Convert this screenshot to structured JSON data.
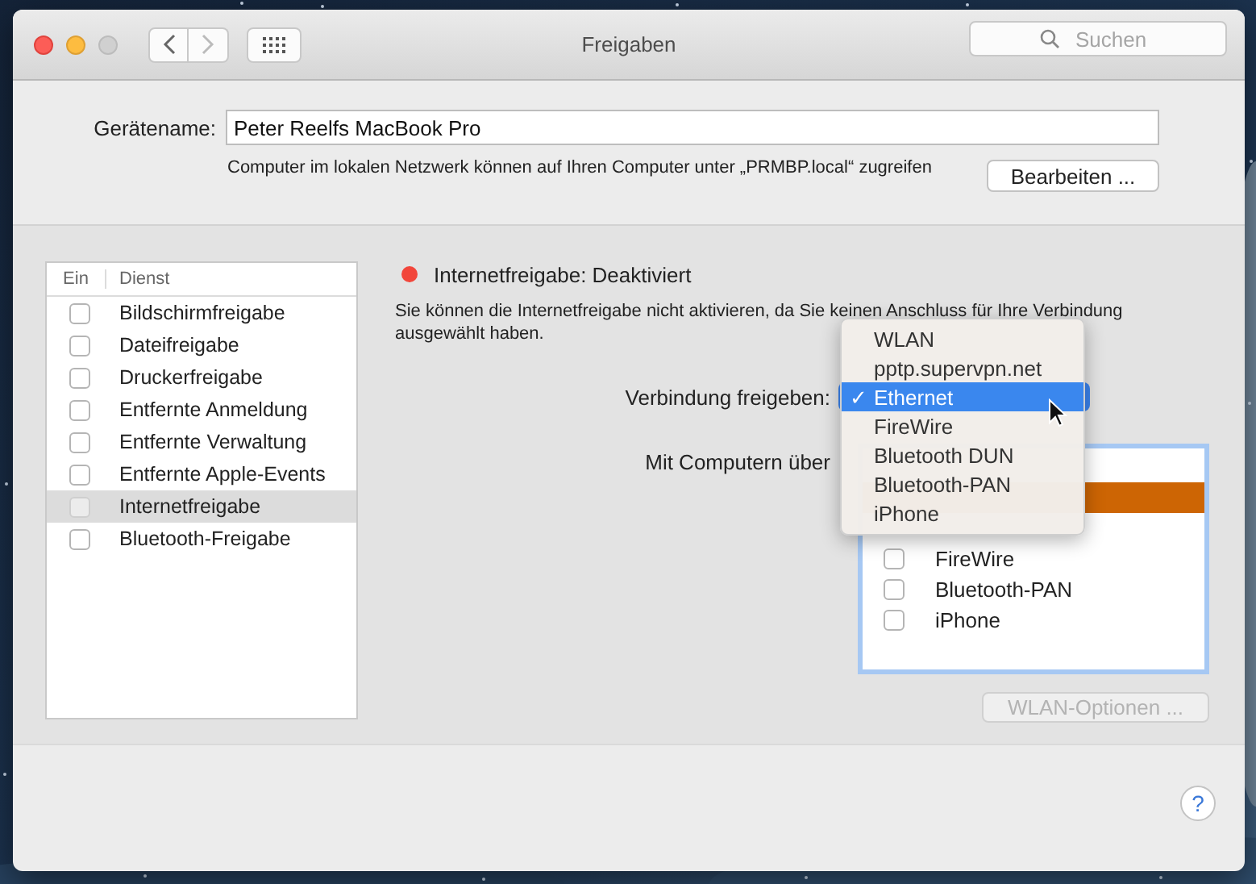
{
  "window": {
    "title": "Freigaben",
    "search": {
      "placeholder": "Suchen"
    }
  },
  "device": {
    "label": "Gerätename:",
    "value": "Peter Reelfs MacBook Pro",
    "hint": "Computer im lokalen Netzwerk können auf Ihren Computer unter „PRMBP.local“ zugreifen",
    "edit_button": "Bearbeiten ..."
  },
  "services": {
    "columns": [
      "Ein",
      "Dienst"
    ],
    "rows": [
      {
        "label": "Bildschirmfreigabe",
        "checked": false,
        "selected": false
      },
      {
        "label": "Dateifreigabe",
        "checked": false,
        "selected": false
      },
      {
        "label": "Druckerfreigabe",
        "checked": false,
        "selected": false
      },
      {
        "label": "Entfernte Anmeldung",
        "checked": false,
        "selected": false
      },
      {
        "label": "Entfernte Verwaltung",
        "checked": false,
        "selected": false
      },
      {
        "label": "Entfernte Apple-Events",
        "checked": false,
        "selected": false
      },
      {
        "label": "Internetfreigabe",
        "checked": false,
        "selected": true
      },
      {
        "label": "Bluetooth-Freigabe",
        "checked": false,
        "selected": false
      }
    ]
  },
  "status": {
    "on": false,
    "text": "Internetfreigabe: Deaktiviert"
  },
  "description": [
    "Sie können die Internetfreigabe nicht aktivieren, da Sie keinen Anschluss für Ihre Verbindung",
    "ausgewählt haben."
  ],
  "share_from": {
    "label": "Verbindung freigeben:",
    "menu": [
      {
        "label": "WLAN",
        "selected": false
      },
      {
        "label": "pptp.supervpn.net",
        "selected": false
      },
      {
        "label": "Ethernet",
        "selected": true,
        "check": "✓"
      },
      {
        "label": "FireWire",
        "selected": false
      },
      {
        "label": "Bluetooth DUN",
        "selected": false
      },
      {
        "label": "Bluetooth-PAN",
        "selected": false
      },
      {
        "label": "iPhone",
        "selected": false
      }
    ]
  },
  "share_to": {
    "label": "Mit Computern über",
    "ports": [
      {
        "selected": false
      },
      {
        "selected": true
      },
      {
        "selected": false
      },
      {
        "label": "FireWire",
        "checked": false,
        "selected": false
      },
      {
        "label": "Bluetooth-PAN",
        "checked": false,
        "selected": false
      },
      {
        "label": "iPhone",
        "checked": false,
        "selected": false
      }
    ]
  },
  "wlan_button": {
    "label": "WLAN-Optionen ...",
    "disabled": true
  },
  "help_button": "?"
}
